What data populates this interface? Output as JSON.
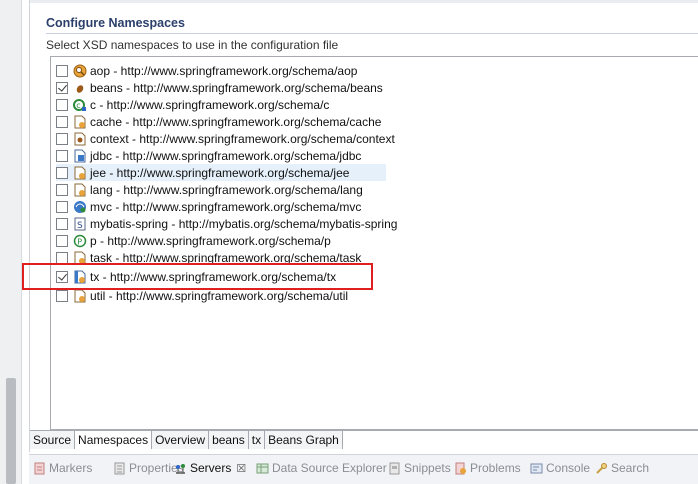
{
  "section": {
    "title": "Configure Namespaces",
    "description": "Select XSD namespaces to use in the configuration file"
  },
  "namespaces": [
    {
      "label": "aop - http://www.springframework.org/schema/aop",
      "checked": false,
      "icon": "aop-icon"
    },
    {
      "label": "beans - http://www.springframework.org/schema/beans",
      "checked": true,
      "icon": "beans-icon"
    },
    {
      "label": "c - http://www.springframework.org/schema/c",
      "checked": false,
      "icon": "c-icon"
    },
    {
      "label": "cache - http://www.springframework.org/schema/cache",
      "checked": false,
      "icon": "cache-icon"
    },
    {
      "label": "context - http://www.springframework.org/schema/context",
      "checked": false,
      "icon": "context-icon"
    },
    {
      "label": "jdbc - http://www.springframework.org/schema/jdbc",
      "checked": false,
      "icon": "jdbc-icon"
    },
    {
      "label": "jee - http://www.springframework.org/schema/jee",
      "checked": false,
      "icon": "jee-icon"
    },
    {
      "label": "lang - http://www.springframework.org/schema/lang",
      "checked": false,
      "icon": "lang-icon"
    },
    {
      "label": "mvc - http://www.springframework.org/schema/mvc",
      "checked": false,
      "icon": "mvc-icon"
    },
    {
      "label": "mybatis-spring - http://mybatis.org/schema/mybatis-spring",
      "checked": false,
      "icon": "mybatis-icon"
    },
    {
      "label": "p - http://www.springframework.org/schema/p",
      "checked": false,
      "icon": "p-icon"
    },
    {
      "label": "task - http://www.springframework.org/schema/task",
      "checked": false,
      "icon": "task-icon"
    },
    {
      "label": "tx - http://www.springframework.org/schema/tx",
      "checked": true,
      "icon": "tx-icon"
    },
    {
      "label": "util - http://www.springframework.org/schema/util",
      "checked": false,
      "icon": "util-icon"
    }
  ],
  "editor_tabs": [
    {
      "label": "Source",
      "active": false
    },
    {
      "label": "Namespaces",
      "active": true
    },
    {
      "label": "Overview",
      "active": false
    },
    {
      "label": "beans",
      "active": false
    },
    {
      "label": "tx",
      "active": false
    },
    {
      "label": "Beans Graph",
      "active": false
    }
  ],
  "views": [
    {
      "label": "Markers",
      "icon": "markers-icon",
      "active": false
    },
    {
      "label": "Properties",
      "icon": "properties-icon",
      "active": false
    },
    {
      "label": "Servers",
      "icon": "servers-icon",
      "active": true
    },
    {
      "label": "Data Source Explorer",
      "icon": "data-source-icon",
      "active": false
    },
    {
      "label": "Snippets",
      "icon": "snippets-icon",
      "active": false
    },
    {
      "label": "Problems",
      "icon": "problems-icon",
      "active": false
    },
    {
      "label": "Console",
      "icon": "console-icon",
      "active": false
    },
    {
      "label": "Search",
      "icon": "search-icon",
      "active": false
    }
  ],
  "views_close": "☒",
  "colors": {
    "highlight": "#e02020",
    "selection": "#e5f0fa",
    "title": "#2b3f6b"
  }
}
